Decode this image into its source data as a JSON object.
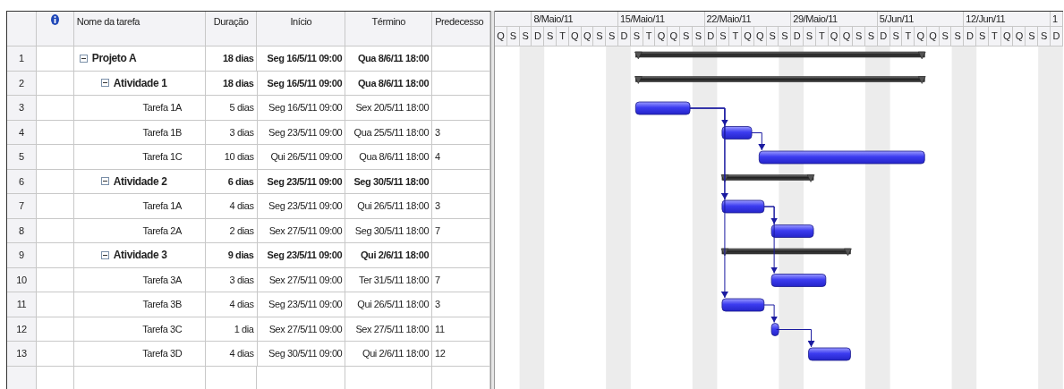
{
  "table": {
    "columns": [
      "Nome da tarefa",
      "Duração",
      "Início",
      "Término",
      "Predecesso"
    ],
    "rows": [
      {
        "id": "1",
        "name": "Projeto A",
        "duration": "18 dias",
        "start": "Seg 16/5/11 09:00",
        "finish": "Qua 8/6/11 18:00",
        "expanded": true,
        "children": [
          {
            "id": "2",
            "name": "Atividade 1",
            "duration": "18 dias",
            "start": "Seg 16/5/11 09:00",
            "finish": "Qua 8/6/11 18:00",
            "expanded": true,
            "children": [
              {
                "id": "3",
                "name": "Tarefa 1A",
                "duration": "5 dias",
                "start": "Seg 16/5/11 09:00",
                "finish": "Sex 20/5/11 18:00"
              },
              {
                "id": "4",
                "name": "Tarefa 1B",
                "duration": "3 dias",
                "start": "Seg 23/5/11 09:00",
                "finish": "Qua 25/5/11 18:00",
                "predecessors": "3"
              },
              {
                "id": "5",
                "name": "Tarefa 1C",
                "duration": "10 dias",
                "start": "Qui 26/5/11 09:00",
                "finish": "Qua 8/6/11 18:00",
                "predecessors": "4"
              }
            ]
          },
          {
            "id": "6",
            "name": "Atividade 2",
            "duration": "6 dias",
            "start": "Seg 23/5/11 09:00",
            "finish": "Seg 30/5/11 18:00",
            "expanded": true,
            "children": [
              {
                "id": "7",
                "name": "Tarefa 1A",
                "duration": "4 dias",
                "start": "Seg 23/5/11 09:00",
                "finish": "Qui 26/5/11 18:00",
                "predecessors": "3"
              },
              {
                "id": "8",
                "name": "Tarefa 2A",
                "duration": "2 dias",
                "start": "Sex 27/5/11 09:00",
                "finish": "Seg 30/5/11 18:00",
                "predecessors": "7"
              }
            ]
          },
          {
            "id": "9",
            "name": "Atividade 3",
            "duration": "9 dias",
            "start": "Seg 23/5/11 09:00",
            "finish": "Qui 2/6/11 18:00",
            "expanded": true,
            "children": [
              {
                "id": "10",
                "name": "Tarefa 3A",
                "duration": "3 dias",
                "start": "Sex 27/5/11 09:00",
                "finish": "Ter 31/5/11 18:00",
                "predecessors": "7"
              },
              {
                "id": "11",
                "name": "Tarefa 3B",
                "duration": "4 dias",
                "start": "Seg 23/5/11 09:00",
                "finish": "Qui 26/5/11 18:00",
                "predecessors": "3"
              },
              {
                "id": "12",
                "name": "Tarefa 3C",
                "duration": "1 dia",
                "start": "Sex 27/5/11 09:00",
                "finish": "Sex 27/5/11 18:00",
                "predecessors": "11"
              },
              {
                "id": "13",
                "name": "Tarefa 3D",
                "duration": "4 dias",
                "start": "Seg 30/5/11 09:00",
                "finish": "Qui 2/6/11 18:00",
                "predecessors": "12"
              }
            ]
          }
        ]
      }
    ]
  },
  "gantt": {
    "days": [
      "Q",
      "S",
      "S",
      "D",
      "S",
      "T",
      "Q",
      "Q",
      "S",
      "S",
      "D",
      "S",
      "T",
      "Q",
      "Q",
      "S",
      "S",
      "D",
      "S",
      "T",
      "Q",
      "Q",
      "S",
      "S",
      "D",
      "S",
      "T",
      "Q",
      "Q",
      "S",
      "S",
      "D",
      "S",
      "T",
      "Q",
      "Q",
      "S",
      "S",
      "D",
      "S",
      "T",
      "Q",
      "Q",
      "S",
      "S",
      "D"
    ],
    "weeks": [
      "8/Maio/11",
      "15/Maio/11",
      "22/Maio/11",
      "29/Maio/11",
      "5/Jun/11",
      "12/Jun/11",
      "1"
    ]
  }
}
